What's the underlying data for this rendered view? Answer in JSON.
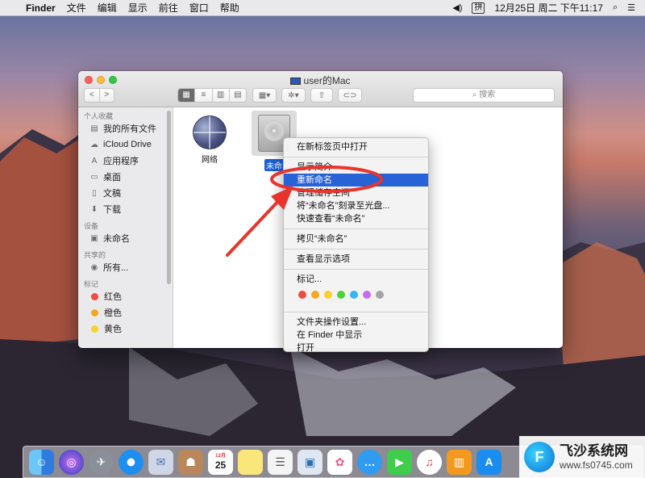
{
  "menubar": {
    "apple": "",
    "app": "Finder",
    "menus": [
      "文件",
      "编辑",
      "显示",
      "前往",
      "窗口",
      "帮助"
    ],
    "datetime": "12月25日 周二 下午11:17",
    "ime": "拼"
  },
  "window": {
    "title": "user的Mac",
    "search_placeholder": "搜索",
    "nav_back": "<",
    "nav_forward": ">"
  },
  "sidebar": {
    "favorites_header": "个人收藏",
    "favorites": [
      {
        "label": "我的所有文件",
        "icon": "all-files-icon"
      },
      {
        "label": "iCloud Drive",
        "icon": "cloud-icon"
      },
      {
        "label": "应用程序",
        "icon": "applications-icon"
      },
      {
        "label": "桌面",
        "icon": "desktop-icon"
      },
      {
        "label": "文稿",
        "icon": "documents-icon"
      },
      {
        "label": "下载",
        "icon": "downloads-icon"
      }
    ],
    "devices_header": "设备",
    "devices": [
      {
        "label": "未命名",
        "icon": "disk-icon"
      }
    ],
    "shared_header": "共享的",
    "shared": [
      {
        "label": "所有...",
        "icon": "network-icon"
      }
    ],
    "tags_header": "标记",
    "tags": [
      {
        "label": "红色",
        "color": "#f24b3f"
      },
      {
        "label": "橙色",
        "color": "#f5a623"
      },
      {
        "label": "黄色",
        "color": "#f8d12f"
      }
    ]
  },
  "files": [
    {
      "label": "网络",
      "icon": "network-globe-icon"
    },
    {
      "label": "未命",
      "icon": "hard-drive-icon",
      "selected": true
    }
  ],
  "context_menu": {
    "items_group1": [
      "在新标签页中打开"
    ],
    "item_info": "显示简介",
    "item_rename": "重新命名",
    "item_manage": "管理储存空间",
    "items_group2": [
      "将“未命名”刻录至光盘...",
      "快速查看“未命名”"
    ],
    "items_group3": [
      "拷贝“未命名”"
    ],
    "items_group4": [
      "查看显示选项"
    ],
    "tags_label": "标记...",
    "tag_colors": [
      "#f24b3f",
      "#f5a623",
      "#f8d12f",
      "#4cd137",
      "#3ab4f2",
      "#c56cf0",
      "#a4a4a4"
    ],
    "items_group5": [
      "文件夹操作设置...",
      "在 Finder 中显示",
      "打开"
    ]
  },
  "dock": {
    "calendar_month": "12月",
    "calendar_day": "25",
    "icons": [
      "finder-icon",
      "siri-icon",
      "launchpad-icon",
      "safari-icon",
      "mail-icon",
      "contacts-icon",
      "calendar-icon",
      "notes-icon",
      "reminders-icon",
      "preview-icon",
      "photos-icon",
      "messages-icon",
      "facetime-icon",
      "music-icon",
      "ibooks-icon",
      "appstore-icon"
    ]
  },
  "watermark": {
    "title": "飞沙系统网",
    "url": "www.fs0745.com",
    "logo": "F"
  }
}
